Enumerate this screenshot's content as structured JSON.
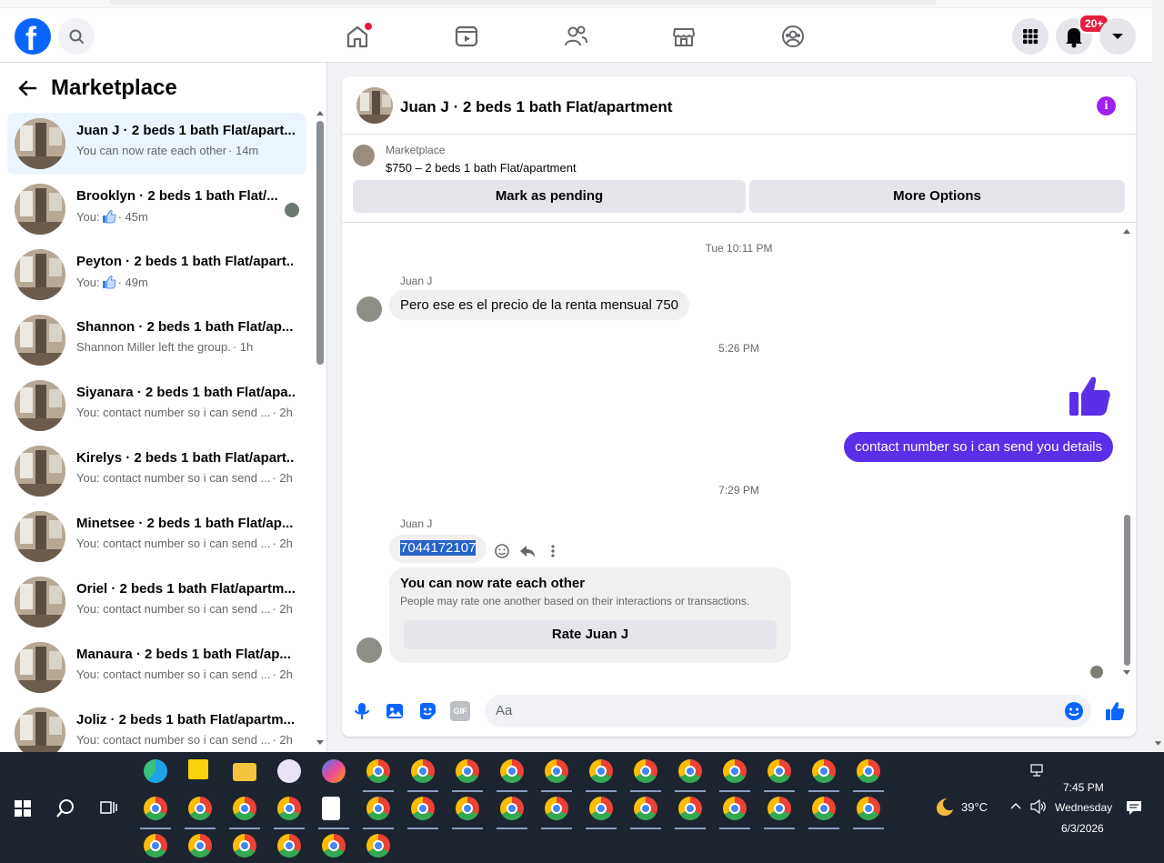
{
  "topnav": {
    "logo": "f",
    "badge": "20+"
  },
  "left": {
    "title": "Marketplace",
    "conversations": [
      {
        "name": "Juan J · 2 beds 1 bath Flat/apart...",
        "preview": "You can now rate each other",
        "time": " · 14m",
        "active": true
      },
      {
        "name": "Brooklyn · 2 beds 1 bath Flat/...",
        "preview": "You:",
        "time": " · 45m",
        "like": true,
        "seen": true
      },
      {
        "name": "Peyton · 2 beds 1 bath Flat/apart...",
        "preview": "You:",
        "time": " · 49m",
        "like": true
      },
      {
        "name": "Shannon · 2 beds 1 bath Flat/ap...",
        "preview": "Shannon Miller left the group.",
        "time": " · 1h"
      },
      {
        "name": "Siyanara · 2 beds 1 bath Flat/apa...",
        "preview": "You: contact number so i can send ...",
        "time": " · 2h"
      },
      {
        "name": "Kirelys · 2 beds 1 bath Flat/apart...",
        "preview": "You: contact number so i can send ...",
        "time": " · 2h"
      },
      {
        "name": "Minetsee · 2 beds 1 bath Flat/ap...",
        "preview": "You: contact number so i can send ...",
        "time": " · 2h"
      },
      {
        "name": "Oriel · 2 beds 1 bath Flat/apartm...",
        "preview": "You: contact number so i can send ...",
        "time": " · 2h"
      },
      {
        "name": "Manaura · 2 beds 1 bath Flat/ap...",
        "preview": "You: contact number so i can send ...",
        "time": " · 2h"
      },
      {
        "name": "Joliz · 2 beds 1 bath Flat/apartm...",
        "preview": "You: contact number so i can send ...",
        "time": " · 2h"
      }
    ]
  },
  "chat": {
    "title": "Juan J · 2 beds 1 bath Flat/apartment",
    "listing_category": "Marketplace",
    "listing_title": "$750 – 2 beds 1 bath Flat/apartment",
    "mark_pending": "Mark as pending",
    "more_options": "More Options",
    "ts1": "Tue 10:11 PM",
    "sender1": "Juan J",
    "msg1": "Pero ese es el precio de la renta mensual 750",
    "ts2": "5:26 PM",
    "msg_out": "contact number so i can send you details",
    "ts3": "7:29 PM",
    "sender2": "Juan J",
    "msg_phone": "7044172107",
    "rate_title": "You can now rate each other",
    "rate_desc": "People may rate one another based on their interactions or transactions.",
    "rate_button": "Rate Juan J",
    "composer_placeholder": "Aa",
    "composer_gif": "GIF"
  },
  "taskbar": {
    "weather": "39°C",
    "time": "7:45 PM",
    "day": "Wednesday",
    "date": "6/3/2026"
  }
}
